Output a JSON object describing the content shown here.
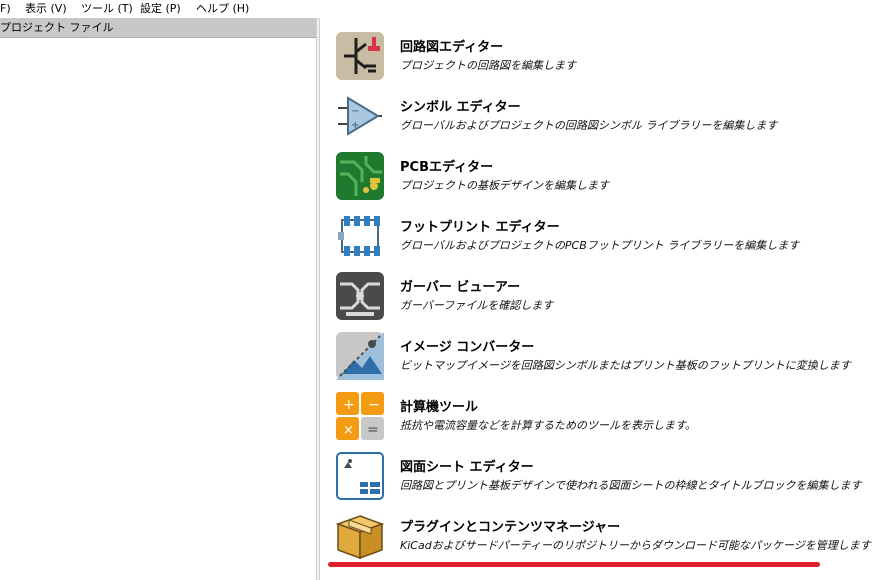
{
  "menu": {
    "items": [
      "F)",
      "表示 (V)",
      "ツール (T)",
      "設定 (P)",
      "ヘルプ (H)"
    ]
  },
  "left_panel": {
    "header": "プロジェクト ファイル"
  },
  "tools": [
    {
      "title": "回路図エディター",
      "desc": "プロジェクトの回路図を編集します",
      "icon": "schematic-editor-icon"
    },
    {
      "title": "シンボル エディター",
      "desc": "グローバルおよびプロジェクトの回路図シンボル ライブラリーを編集します",
      "icon": "symbol-editor-icon"
    },
    {
      "title": "PCBエディター",
      "desc": "プロジェクトの基板デザインを編集します",
      "icon": "pcb-editor-icon"
    },
    {
      "title": "フットプリント エディター",
      "desc": "グローバルおよびプロジェクトのPCBフットプリント ライブラリーを編集します",
      "icon": "footprint-editor-icon"
    },
    {
      "title": "ガーバー ビューアー",
      "desc": "ガーバーファイルを確認します",
      "icon": "gerber-viewer-icon"
    },
    {
      "title": "イメージ コンバーター",
      "desc": "ビットマップイメージを回路図シンボルまたはプリント基板のフットプリントに変換します",
      "icon": "image-converter-icon"
    },
    {
      "title": "計算機ツール",
      "desc": "抵抗や電流容量などを計算するためのツールを表示します。",
      "icon": "calculator-icon"
    },
    {
      "title": "図面シート エディター",
      "desc": "回路図とプリント基板デザインで使われる図面シートの枠線とタイトルブロックを編集します",
      "icon": "drawing-sheet-editor-icon"
    },
    {
      "title": "プラグインとコンテンツマネージャー",
      "desc": "KiCadおよびサードパーティーのリポジトリーからダウンロード可能なパッケージを管理します",
      "icon": "package-icon"
    }
  ],
  "colors": {
    "highlight_underline": "#e0212b",
    "panel_header": "#c8c8c8"
  }
}
